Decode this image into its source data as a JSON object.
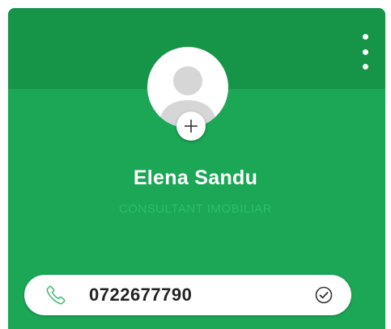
{
  "profile": {
    "name": "Elena Sandu",
    "role": "CONSULTANT IMOBILIAR",
    "phone": "0722677790"
  },
  "icons": {
    "menu": "more-vertical-icon",
    "avatar": "person-avatar-icon",
    "add_photo": "plus-icon",
    "phone": "phone-icon",
    "verified": "check-circle-icon"
  },
  "colors": {
    "header": "#169448",
    "body": "#1ba756",
    "role_text": "#2bbf68",
    "phone_icon": "#3cba6e",
    "avatar_figure": "#d6d6d6"
  }
}
